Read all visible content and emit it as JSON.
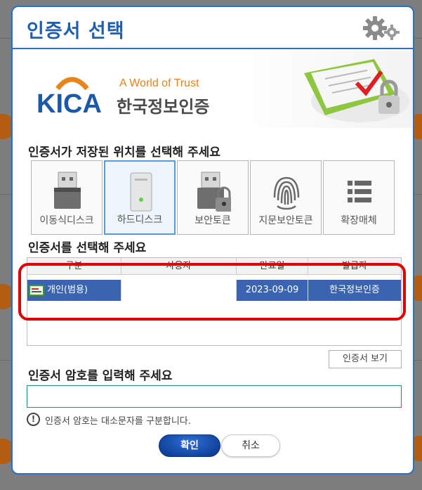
{
  "dialog": {
    "title": "인증서 선택",
    "settings_icon": "gear-icon"
  },
  "banner": {
    "brand_mark": "KICA",
    "tagline": "A World of Trust",
    "org_name": "한국정보인증"
  },
  "storage": {
    "heading": "인증서가 저장된 위치를 선택해 주세요",
    "selected": "하드디스크",
    "items": [
      {
        "label": "이동식디스크",
        "icon": "usb-drive-icon"
      },
      {
        "label": "하드디스크",
        "icon": "hard-disk-icon"
      },
      {
        "label": "보안토큰",
        "icon": "security-token-icon"
      },
      {
        "label": "지문보안토큰",
        "icon": "fingerprint-icon"
      },
      {
        "label": "확장매체",
        "icon": "list-icon"
      }
    ]
  },
  "cert_list": {
    "heading": "인증서를 선택해 주세요",
    "columns": [
      "구분",
      "사용자",
      "만료일",
      "발급자"
    ],
    "rows": [
      {
        "type": "개인(범용)",
        "user": "",
        "expiry": "2023-09-09",
        "issuer": "한국정보인증"
      }
    ]
  },
  "view_cert_button": "인증서 보기",
  "password": {
    "heading": "인증서 암호를 입력해 주세요",
    "value": "",
    "hint": "인증서 암호는 대소문자를 구분합니다."
  },
  "buttons": {
    "ok": "확인",
    "cancel": "취소"
  },
  "colors": {
    "accent": "#2d6fc5",
    "selected_row": "#3b64b0",
    "highlight_outline": "#e00000"
  }
}
